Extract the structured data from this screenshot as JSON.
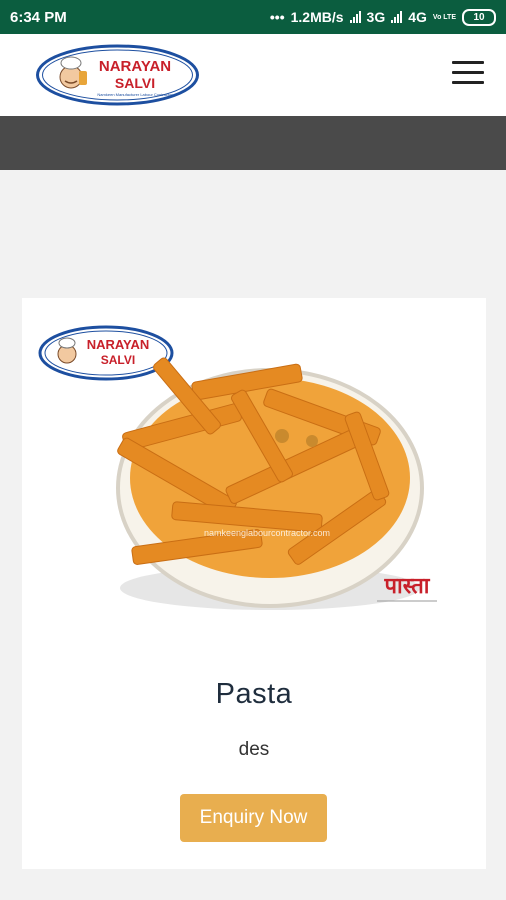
{
  "status_bar": {
    "time": "6:34 PM",
    "dots": "•••",
    "speed": "1.2MB/s",
    "net1": "3G",
    "net2": "4G",
    "volte": "Vo LTE",
    "battery": "10"
  },
  "header": {
    "logo_line1": "NARAYAN",
    "logo_line2": "SALVI",
    "logo_tagline": "Namkeen Manufacturer Labour Contractor"
  },
  "product": {
    "image_logo_line1": "NARAYAN",
    "image_logo_line2": "SALVI",
    "image_watermark": "namkeenglabourcontractor.com",
    "image_label": "पास्ता",
    "title": "Pasta",
    "description": "des",
    "button_label": "Enquiry Now"
  },
  "colors": {
    "status_bar": "#0b5d3f",
    "nav_bar": "#4a4a4a",
    "button": "#e8ae4f",
    "logo_text": "#c8202a",
    "logo_ring": "#1d4fa0"
  }
}
